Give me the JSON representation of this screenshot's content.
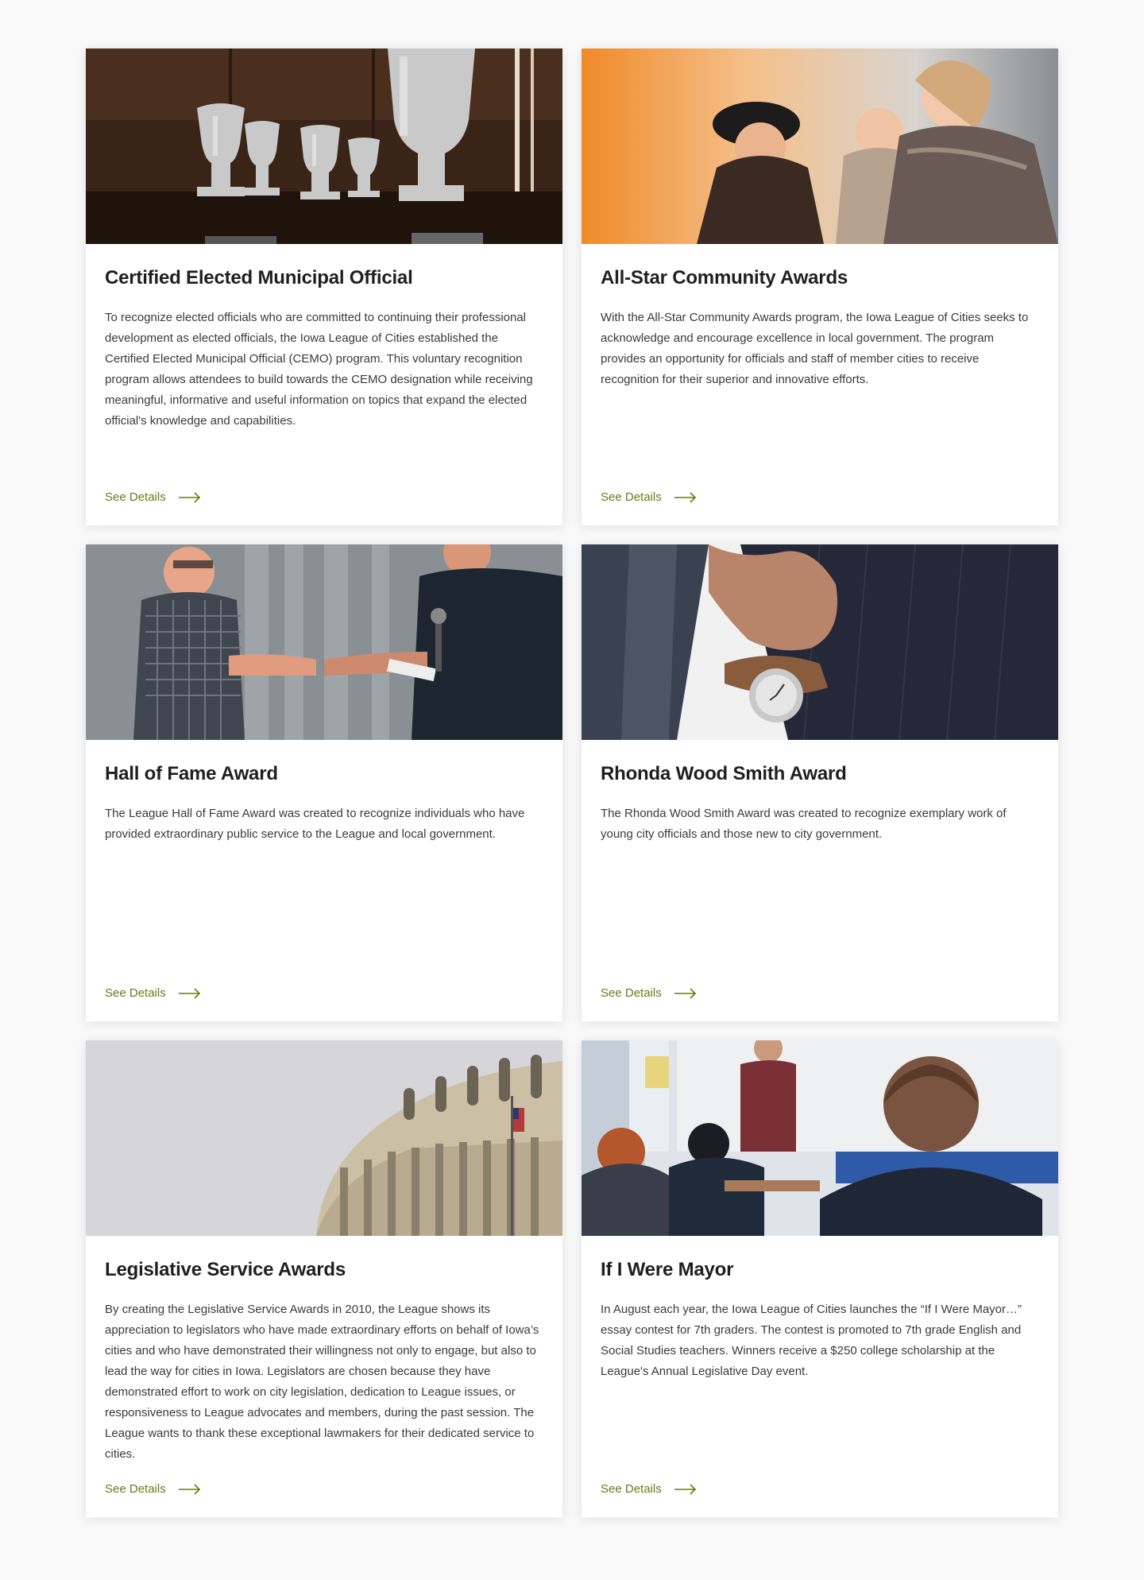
{
  "cards": [
    {
      "title": "Certified Elected Municipal Official",
      "description": "To recognize elected officials who are committed to continuing their professional development as elected officials, the Iowa League of Cities established the Certified Elected Municipal Official (CEMO) program. This voluntary recognition program allows attendees to build towards the CEMO designation while receiving meaningful, informative and useful information on topics that expand the elected official's knowledge and capabilities.",
      "link_label": "See Details",
      "image": "trophies-photo"
    },
    {
      "title": "All-Star Community Awards",
      "description": "With the All-Star Community Awards program, the Iowa League of Cities seeks to acknowledge and encourage excellence in local government. The program provides an opportunity for officials and staff of member cities to receive recognition for their superior and innovative efforts.",
      "link_label": "See Details",
      "image": "celebrating-women-photo"
    },
    {
      "title": "Hall of Fame Award",
      "description": "The League Hall of Fame Award was created to recognize individuals who have provided extraordinary public service to the League and local government.",
      "link_label": "See Details",
      "image": "handshake-photo"
    },
    {
      "title": "Rhonda Wood Smith Award",
      "description": "The Rhonda Wood Smith Award was created to recognize exemplary work of young city officials and those new to city government.",
      "link_label": "See Details",
      "image": "suit-watch-photo"
    },
    {
      "title": "Legislative Service Awards",
      "description": "By creating the Legislative Service Awards in 2010, the League shows its appreciation to legislators who have made extraordinary efforts on behalf of Iowa’s cities and who have demonstrated their willingness not only to engage, but also to lead the way for cities in Iowa. Legislators are chosen because they have demonstrated effort to work on city legislation, dedication to League issues, or responsiveness to League advocates and members, during the past session. The League wants to thank these exceptional lawmakers for their dedicated service to cities.",
      "link_label": "See Details",
      "image": "capitol-dome-photo"
    },
    {
      "title": "If I Were Mayor",
      "description": "In August each year, the Iowa League of Cities launches the “If I Were Mayor…” essay contest for 7th graders. The contest is promoted to 7th grade English and Social Studies teachers. Winners receive a $250 college scholarship at the League's Annual Legislative Day event.",
      "link_label": "See Details",
      "image": "classroom-photo"
    }
  ],
  "colors": {
    "accent": "#6b7a12",
    "title": "#1f1f1f",
    "text": "#3a3a3a",
    "background": "#f9f9f9"
  }
}
